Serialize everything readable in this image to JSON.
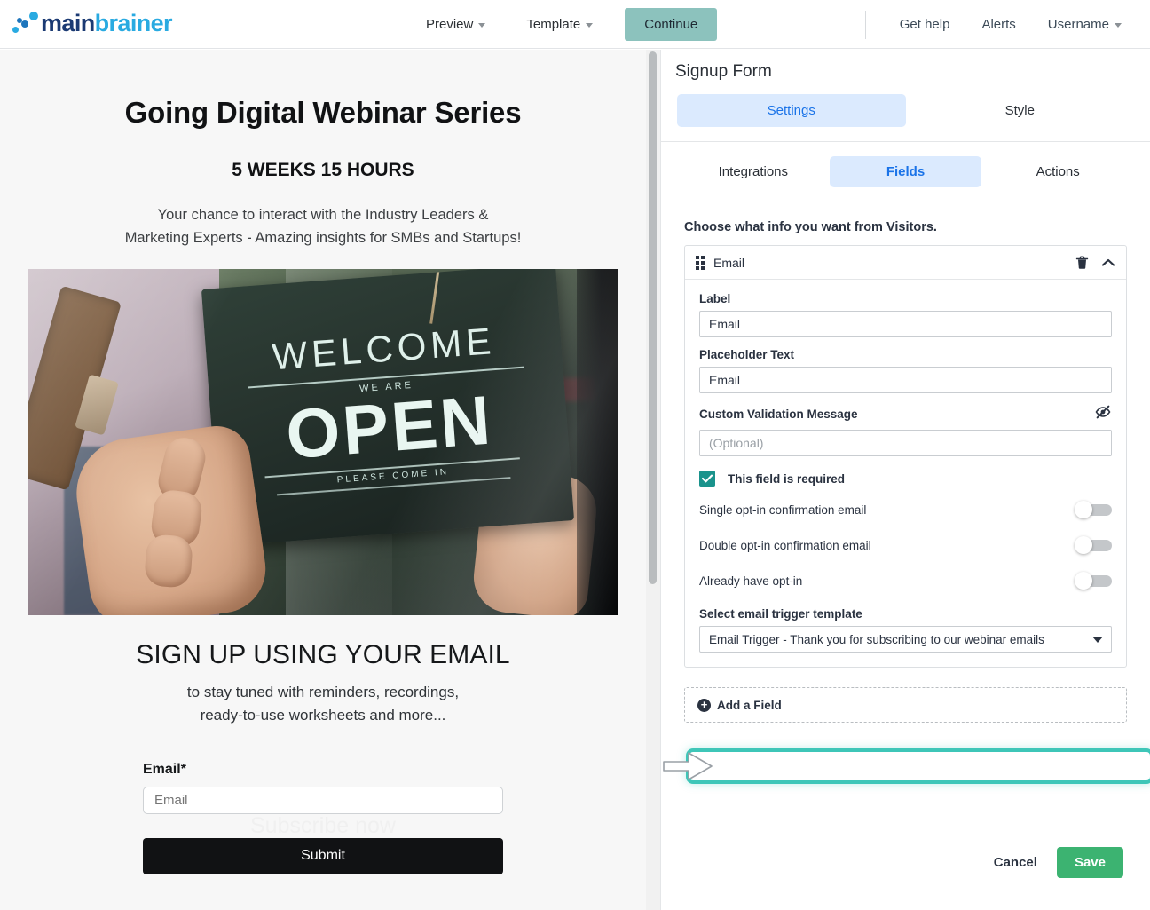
{
  "topbar": {
    "logo_main": "main",
    "logo_brainer": "brainer",
    "nav": [
      {
        "label": "Preview",
        "has_caret": true
      },
      {
        "label": "Template",
        "has_caret": true
      }
    ],
    "continue_label": "Continue",
    "right_nav": [
      {
        "label": "Get help",
        "has_caret": false
      },
      {
        "label": "Alerts",
        "has_caret": false
      },
      {
        "label": "Username",
        "has_caret": true
      }
    ]
  },
  "preview": {
    "heading": "Going Digital Webinar Series",
    "subheading": "5 WEEKS 15 HOURS",
    "intro_line1": "Your chance to interact with the Industry Leaders &",
    "intro_line2": "Marketing Experts - Amazing insights for SMBs and Startups!",
    "image": {
      "alt": "welcome-we-are-open-sign-photo",
      "sign_welcome": "WELCOME",
      "sign_weare": "WE ARE",
      "sign_open": "OPEN",
      "sign_please": "PLEASE COME IN"
    },
    "signup_heading": "SIGN UP USING YOUR EMAIL",
    "signup_sub_line1": "to stay tuned with reminders, recordings,",
    "signup_sub_line2": "ready-to-use worksheets and more...",
    "field_label": "Email*",
    "field_placeholder": "Email",
    "ghost_text": "Subscribe now",
    "submit_label": "Submit"
  },
  "panel": {
    "title": "Signup Form",
    "primary_tabs": [
      {
        "label": "Settings",
        "active": true
      },
      {
        "label": "Style",
        "active": false
      }
    ],
    "secondary_tabs": [
      {
        "label": "Integrations",
        "active": false
      },
      {
        "label": "Fields",
        "active": true
      },
      {
        "label": "Actions",
        "active": false
      }
    ],
    "choose_text": "Choose what info you want from Visitors.",
    "field": {
      "name": "Email",
      "label_caption": "Label",
      "label_value": "Email",
      "placeholder_caption": "Placeholder Text",
      "placeholder_value": "Email",
      "validation_caption": "Custom Validation Message",
      "validation_placeholder": "(Optional)",
      "required_label": "This field is required",
      "required_checked": true,
      "toggles": [
        {
          "label": "Single opt-in confirmation email",
          "on": false,
          "highlighted": true
        },
        {
          "label": "Double opt-in confirmation email",
          "on": false,
          "highlighted": false
        },
        {
          "label": "Already have opt-in",
          "on": false,
          "highlighted": false
        }
      ],
      "trigger_caption": "Select email trigger template",
      "trigger_value": "Email Trigger - Thank you for subscribing to our webinar emails"
    },
    "add_field_label": "Add a Field",
    "cancel_label": "Cancel",
    "save_label": "Save"
  },
  "colors": {
    "accent_blue": "#1a73e8",
    "tab_active_bg": "#dbeafe",
    "continue_btn": "#8cc2bd",
    "save_btn": "#3cb371",
    "checkbox_teal": "#1a938c",
    "highlight_ring": "#3ec6b8",
    "logo_dark": "#1b3a73",
    "logo_light": "#29aae1"
  }
}
